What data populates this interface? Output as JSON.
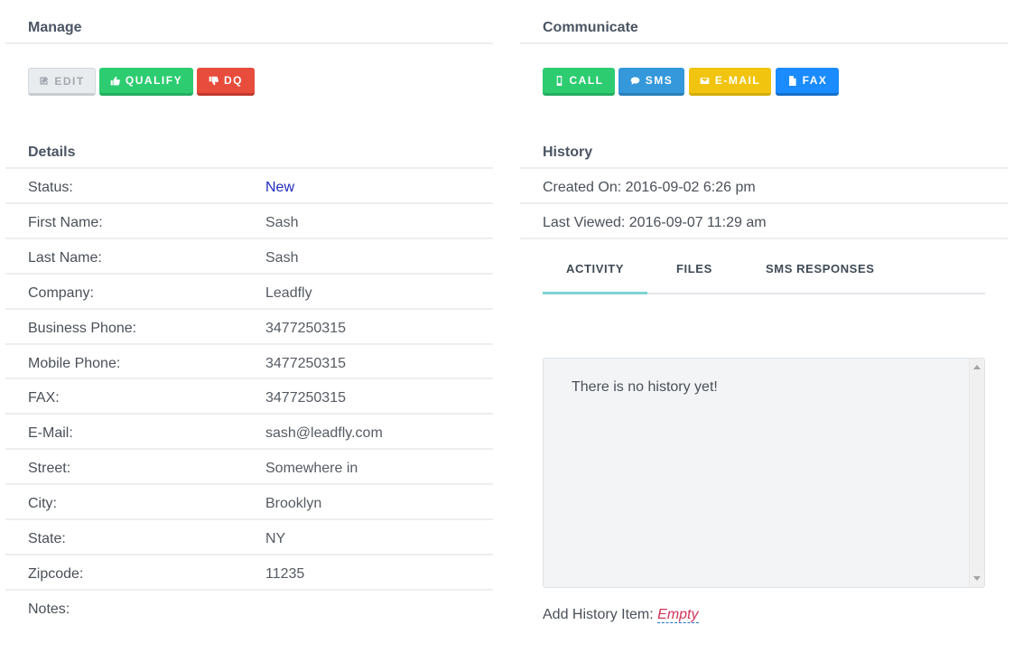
{
  "manage": {
    "title": "Manage",
    "buttons": {
      "edit": "EDIT",
      "qualify": "QUALIFY",
      "dq": "DQ"
    }
  },
  "communicate": {
    "title": "Communicate",
    "buttons": {
      "call": "CALL",
      "sms": "SMS",
      "email": "E-MAIL",
      "fax": "FAX"
    }
  },
  "details": {
    "title": "Details",
    "rows": [
      {
        "label": "Status:",
        "value": "New"
      },
      {
        "label": "First Name:",
        "value": "Sash"
      },
      {
        "label": "Last Name:",
        "value": "Sash"
      },
      {
        "label": "Company:",
        "value": "Leadfly"
      },
      {
        "label": "Business Phone:",
        "value": "3477250315"
      },
      {
        "label": "Mobile Phone:",
        "value": "3477250315"
      },
      {
        "label": "FAX:",
        "value": "3477250315"
      },
      {
        "label": "E-Mail:",
        "value": "sash@leadfly.com"
      },
      {
        "label": "Street:",
        "value": "Somewhere in"
      },
      {
        "label": "City:",
        "value": "Brooklyn"
      },
      {
        "label": "State:",
        "value": "NY"
      },
      {
        "label": "Zipcode:",
        "value": "11235"
      },
      {
        "label": "Notes:",
        "value": ""
      }
    ]
  },
  "history": {
    "title": "History",
    "created_on": "Created On: 2016-09-02 6:26 pm",
    "last_viewed": "Last Viewed: 2016-09-07 11:29 am",
    "tabs": [
      "ACTIVITY",
      "FILES",
      "SMS RESPONSES"
    ],
    "active_tab": "ACTIVITY",
    "empty_message": "There is no history yet!",
    "add_label": "Add History Item:",
    "add_value": "Empty"
  },
  "colors": {
    "qualify": "#2ecc71",
    "dq": "#e74c3c",
    "sms": "#3498db",
    "email": "#f1c40f",
    "fax": "#1a8cff",
    "link": "#1f2bc0",
    "tab_underline": "#7fd3d4"
  }
}
